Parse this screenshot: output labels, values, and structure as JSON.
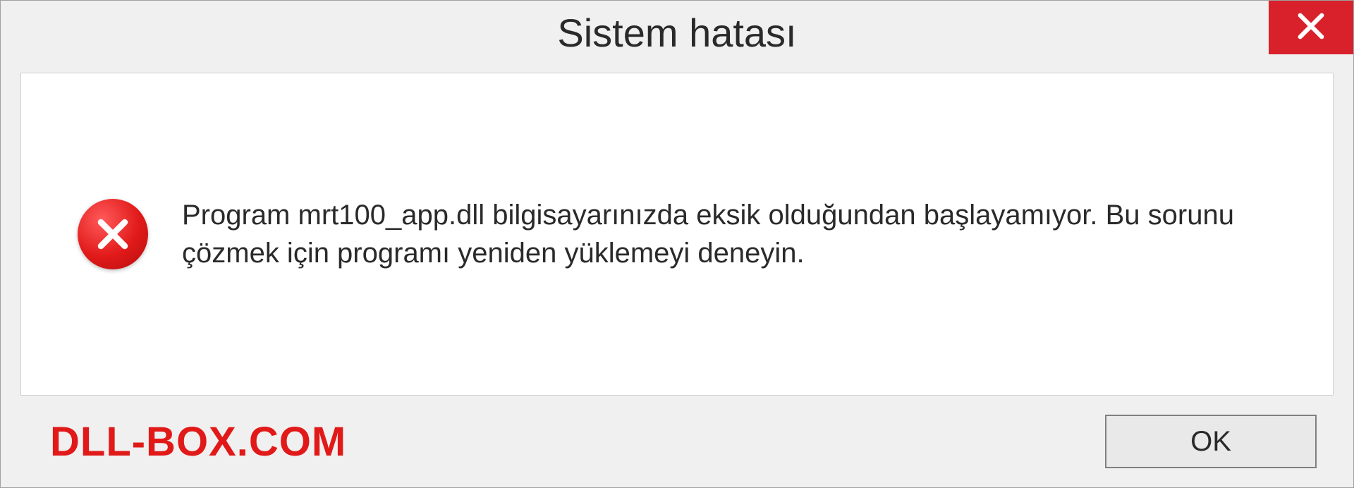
{
  "title": "Sistem hatası",
  "message": "Program mrt100_app.dll bilgisayarınızda eksik olduğundan başlayamıyor. Bu sorunu çözmek için programı yeniden yüklemeyi deneyin.",
  "footer": {
    "watermark": "DLL-BOX.COM",
    "ok_label": "OK"
  }
}
